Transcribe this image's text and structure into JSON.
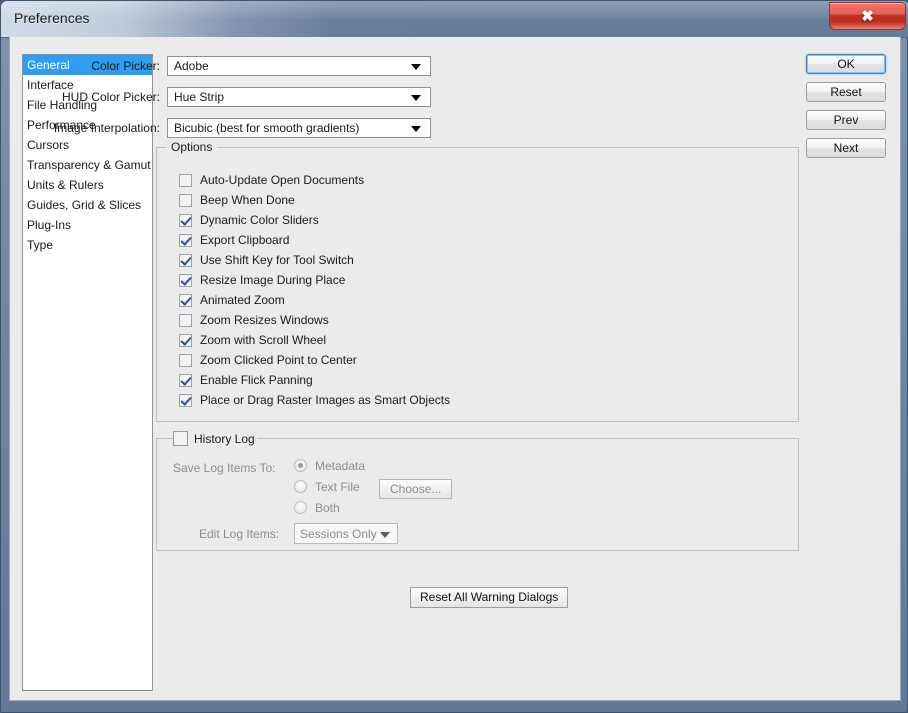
{
  "window": {
    "title": "Preferences",
    "close_label": "✖",
    "close_icon": "close-icon",
    "accent_titlebar": "#6c819f",
    "accent_close": "#c03123",
    "accent_selection": "#2f9ef2",
    "background": "#ebebeb"
  },
  "sidebar": {
    "items": [
      {
        "label": "General",
        "selected": true
      },
      {
        "label": "Interface",
        "selected": false
      },
      {
        "label": "File Handling",
        "selected": false
      },
      {
        "label": "Performance",
        "selected": false
      },
      {
        "label": "Cursors",
        "selected": false
      },
      {
        "label": "Transparency & Gamut",
        "selected": false
      },
      {
        "label": "Units & Rulers",
        "selected": false
      },
      {
        "label": "Guides, Grid & Slices",
        "selected": false
      },
      {
        "label": "Plug-Ins",
        "selected": false
      },
      {
        "label": "Type",
        "selected": false
      }
    ]
  },
  "action_buttons": [
    {
      "label": "OK",
      "default": true
    },
    {
      "label": "Reset",
      "default": false
    },
    {
      "label": "Prev",
      "default": false
    },
    {
      "label": "Next",
      "default": false
    }
  ],
  "form_rows": [
    {
      "label": "Color Picker:",
      "value": "Adobe"
    },
    {
      "label": "HUD Color Picker:",
      "value": "Hue Strip"
    },
    {
      "label": "Image Interpolation:",
      "value": "Bicubic (best for smooth gradients)"
    }
  ],
  "options_group": {
    "title": "Options",
    "checkboxes": [
      {
        "label": "Auto-Update Open Documents",
        "checked": false
      },
      {
        "label": "Beep When Done",
        "checked": false
      },
      {
        "label": "Dynamic Color Sliders",
        "checked": true
      },
      {
        "label": "Export Clipboard",
        "checked": true
      },
      {
        "label": "Use Shift Key for Tool Switch",
        "checked": true
      },
      {
        "label": "Resize Image During Place",
        "checked": true
      },
      {
        "label": "Animated Zoom",
        "checked": true
      },
      {
        "label": "Zoom Resizes Windows",
        "checked": false
      },
      {
        "label": "Zoom with Scroll Wheel",
        "checked": true
      },
      {
        "label": "Zoom Clicked Point to Center",
        "checked": false
      },
      {
        "label": "Enable Flick Panning",
        "checked": true
      },
      {
        "label": "Place or Drag Raster Images as Smart Objects",
        "checked": true
      }
    ]
  },
  "history_log_group": {
    "title": "History Log",
    "enabled": false,
    "checked": false,
    "save_log_label": "Save Log Items To:",
    "radios": [
      {
        "label": "Metadata",
        "selected": true
      },
      {
        "label": "Text File",
        "selected": false
      },
      {
        "label": "Both",
        "selected": false
      }
    ],
    "choose_button": "Choose...",
    "edit_log_label": "Edit Log Items:",
    "edit_log_value": "Sessions Only"
  },
  "reset_warnings_button": "Reset All Warning Dialogs"
}
